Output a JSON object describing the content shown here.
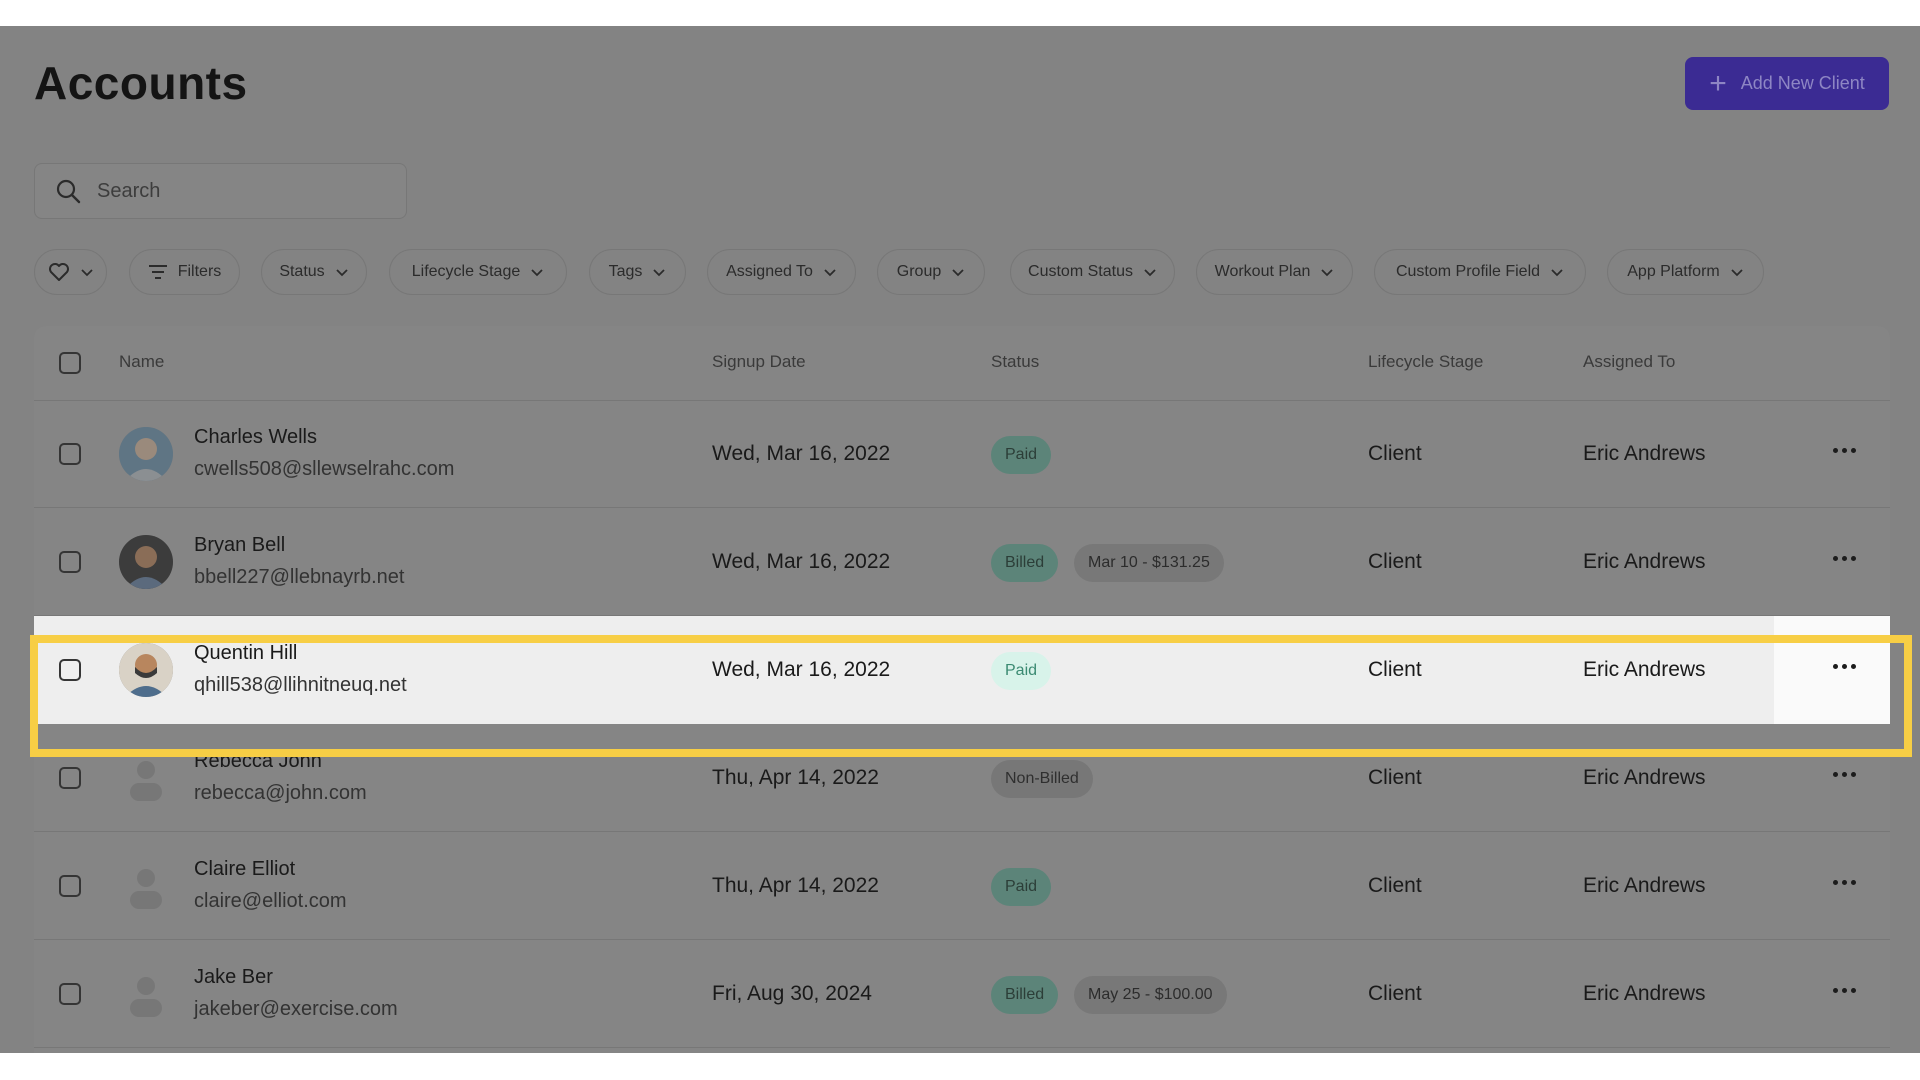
{
  "page": {
    "title": "Accounts"
  },
  "actions": {
    "add_client_label": "Add New Client"
  },
  "search": {
    "placeholder": "Search",
    "value": ""
  },
  "filters": [
    {
      "label": "",
      "icon": "heart-icon"
    },
    {
      "label": "Filters",
      "icon": "filter-lines-icon"
    },
    {
      "label": "Status"
    },
    {
      "label": "Lifecycle Stage"
    },
    {
      "label": "Tags"
    },
    {
      "label": "Assigned To"
    },
    {
      "label": "Group"
    },
    {
      "label": "Custom Status"
    },
    {
      "label": "Workout Plan"
    },
    {
      "label": "Custom Profile Field"
    },
    {
      "label": "App Platform"
    }
  ],
  "table": {
    "headers": {
      "name": "Name",
      "signup": "Signup Date",
      "status": "Status",
      "stage": "Lifecycle Stage",
      "assigned": "Assigned To"
    },
    "rows": [
      {
        "name": "Charles Wells",
        "email": "cwells508@sllewselrahc.com",
        "date": "Wed, Mar 16, 2022",
        "status": "Paid",
        "amount": "",
        "stage": "Client",
        "assigned": "Eric Andrews",
        "avatar": "photo"
      },
      {
        "name": "Bryan Bell",
        "email": "bbell227@llebnayrb.net",
        "date": "Wed, Mar 16, 2022",
        "status": "Billed",
        "amount": "Mar 10 - $131.25",
        "stage": "Client",
        "assigned": "Eric Andrews",
        "avatar": "photo"
      },
      {
        "name": "Quentin Hill",
        "email": "qhill538@llihnitneuq.net",
        "date": "Wed, Mar 16, 2022",
        "status": "Paid",
        "amount": "",
        "stage": "Client",
        "assigned": "Eric Andrews",
        "avatar": "photo"
      },
      {
        "name": "Rebecca John",
        "email": "rebecca@john.com",
        "date": "Thu, Apr 14, 2022",
        "status": "Non-Billed",
        "amount": "",
        "stage": "Client",
        "assigned": "Eric Andrews",
        "avatar": "placeholder"
      },
      {
        "name": "Claire Elliot",
        "email": "claire@elliot.com",
        "date": "Thu, Apr 14, 2022",
        "status": "Paid",
        "amount": "",
        "stage": "Client",
        "assigned": "Eric Andrews",
        "avatar": "placeholder"
      },
      {
        "name": "Jake Ber",
        "email": "jakeber@exercise.com",
        "date": "Fri, Aug 30, 2024",
        "status": "Billed",
        "amount": "May 25 - $100.00",
        "stage": "Client",
        "assigned": "Eric Andrews",
        "avatar": "placeholder"
      }
    ]
  },
  "colors": {
    "overlay": "#838383",
    "primary_button": "#3b2b93",
    "highlight_border": "#f7ce45",
    "paid_badge_highlight": "#d8f3ea"
  }
}
